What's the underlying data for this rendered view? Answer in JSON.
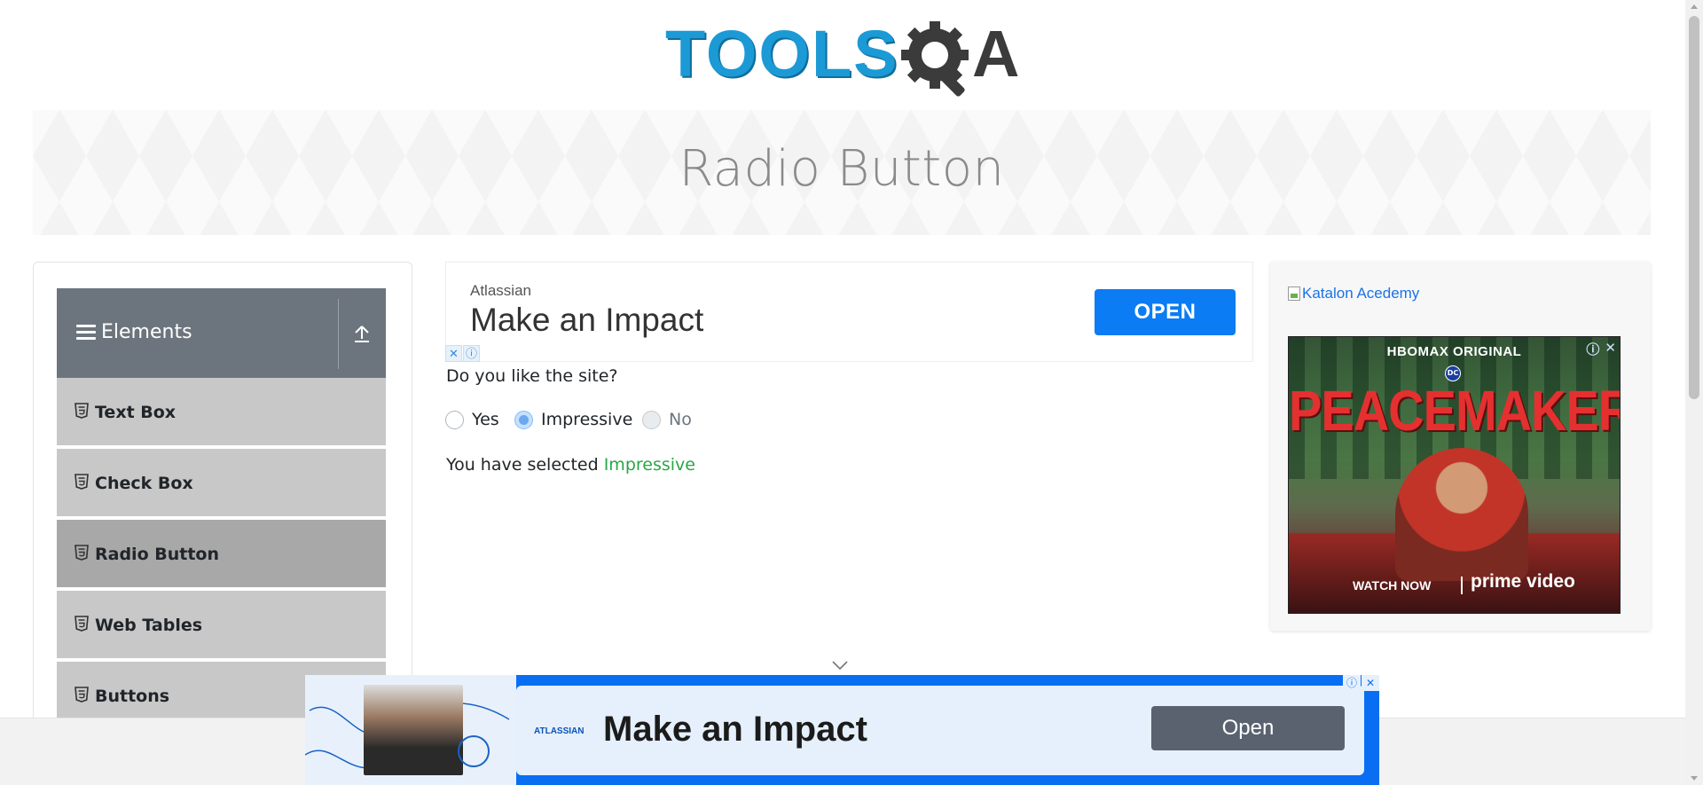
{
  "header": {
    "logo_text": "TOOLS",
    "logo_suffix": "A",
    "logo_alt": "ToolsQA"
  },
  "banner": {
    "title": "Radio Button"
  },
  "sidebar": {
    "group_title": "Elements",
    "items": [
      {
        "label": "Text Box",
        "active": false
      },
      {
        "label": "Check Box",
        "active": false
      },
      {
        "label": "Radio Button",
        "active": true
      },
      {
        "label": "Web Tables",
        "active": false
      },
      {
        "label": "Buttons",
        "active": false
      }
    ]
  },
  "top_ad": {
    "brand": "Atlassian",
    "headline": "Make an Impact",
    "button_label": "OPEN",
    "close_glyph": "✕",
    "info_glyph": "ⓘ"
  },
  "form": {
    "question": "Do you like the site?",
    "options": [
      {
        "label": "Yes",
        "state": "unchecked"
      },
      {
        "label": "Impressive",
        "state": "checked"
      },
      {
        "label": "No",
        "state": "disabled"
      }
    ],
    "result_prefix": "You have selected ",
    "result_value": "Impressive"
  },
  "right_ad": {
    "broken_image_alt": "Katalon Acedemy",
    "poster": {
      "network": "HBOMAX ORIGINAL",
      "dc_badge": "DC",
      "title": "PEACEMAKER",
      "cta": "WATCH NOW",
      "platform": "prime video",
      "info_glyph": "ⓘ",
      "close_glyph": "✕"
    }
  },
  "bottom_ad": {
    "small_brand": "ATLASSIAN",
    "headline": "Make an Impact",
    "button_label": "Open",
    "info_glyph": "ⓘ",
    "close_glyph": "✕"
  },
  "colors": {
    "brand_blue": "#1b9ad6",
    "success": "#28a745",
    "sidebar_header": "#6c757d",
    "ad_blue": "#0a6ef2"
  }
}
